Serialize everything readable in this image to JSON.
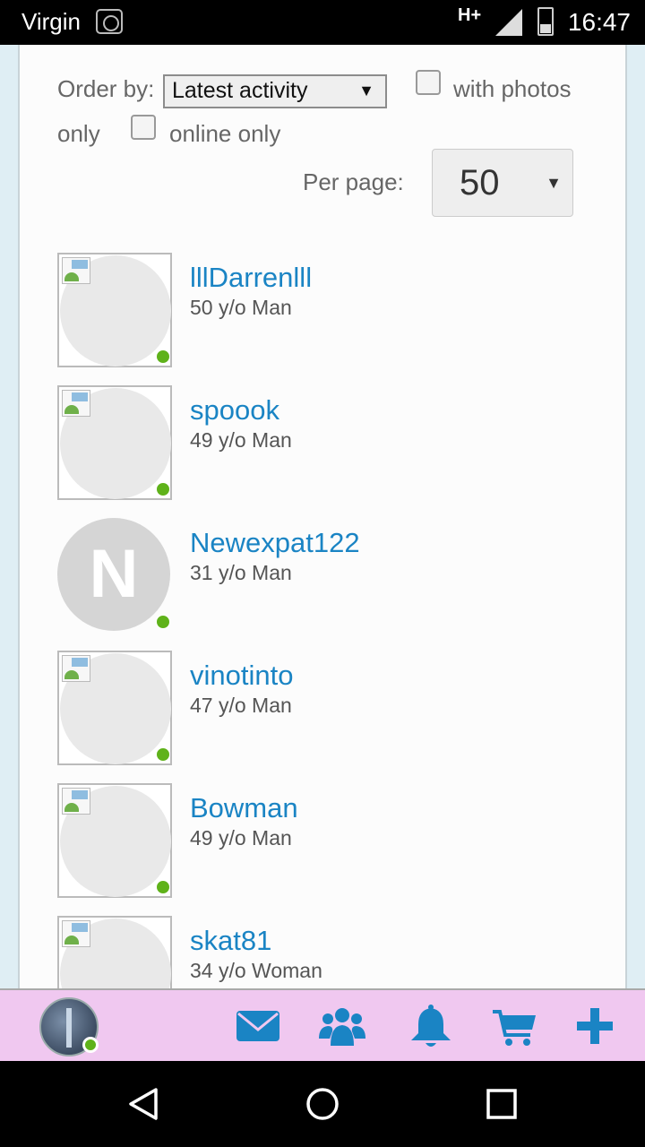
{
  "status_bar": {
    "carrier": "Virgin",
    "network": "H+",
    "time": "16:47"
  },
  "filters": {
    "order_by_label": "Order by:",
    "order_by_value": "Latest activity",
    "with_photos_label": "with photos",
    "only_label": "only",
    "online_only_label": "online only",
    "per_page_label": "Per page:",
    "per_page_value": "50"
  },
  "members": [
    {
      "name": "lllDarrenlll",
      "details": "50 y/o Man",
      "online": true
    },
    {
      "name": "spoook",
      "details": "49 y/o Man",
      "online": true
    },
    {
      "name": "Newexpat122",
      "details": "31 y/o Man",
      "online": true,
      "initial": "N"
    },
    {
      "name": "vinotinto",
      "details": "47 y/o Man",
      "online": true
    },
    {
      "name": "Bowman",
      "details": "49 y/o Man",
      "online": true
    },
    {
      "name": "skat81",
      "details": "34 y/o Woman",
      "online": false
    }
  ],
  "colors": {
    "link": "#1a84c4",
    "online_dot": "#5fb21a",
    "idle_dot": "#9a9b62",
    "appbar_bg": "#f0c8f0",
    "icon_blue": "#1a84c4"
  },
  "appbar": {
    "icons": [
      "mail-icon",
      "friends-icon",
      "bell-icon",
      "cart-icon",
      "plus-icon"
    ]
  }
}
